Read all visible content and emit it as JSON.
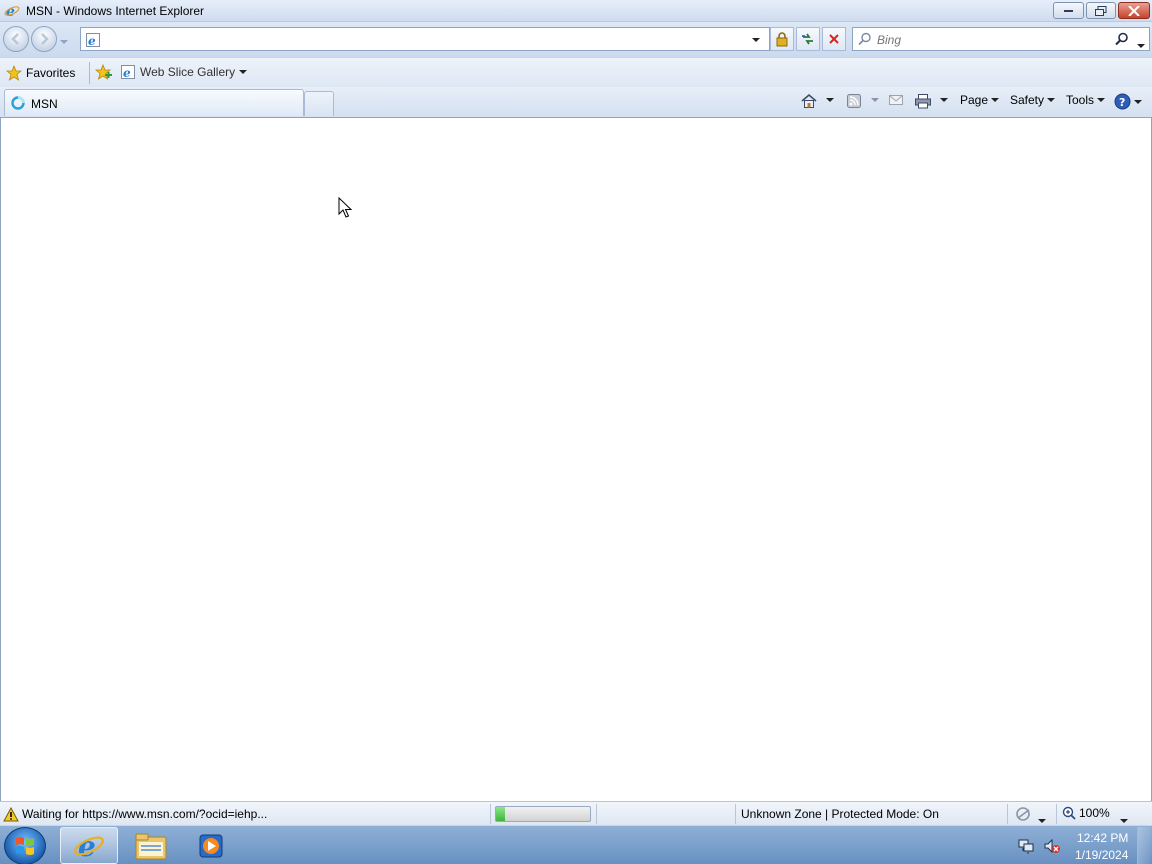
{
  "window": {
    "title": "MSN - Windows Internet Explorer"
  },
  "nav": {
    "address_value": "",
    "search_placeholder": "Bing"
  },
  "favorites": {
    "favorites_label": "Favorites",
    "web_slice_label": "Web Slice Gallery"
  },
  "tabs": [
    {
      "label": "MSN",
      "active": true
    }
  ],
  "command_bar": {
    "page_label": "Page",
    "safety_label": "Safety",
    "tools_label": "Tools"
  },
  "status": {
    "text": "Waiting for https://www.msn.com/?ocid=iehp...",
    "progress": 0.1,
    "zone": "Unknown Zone | Protected Mode: On",
    "zoom": "100%"
  },
  "taskbar": {
    "time": "12:42 PM",
    "date": "1/19/2024"
  },
  "colors": {
    "accent": "#3cb63a",
    "taskbar": "#6790c1",
    "close_button": "#c8432c"
  }
}
